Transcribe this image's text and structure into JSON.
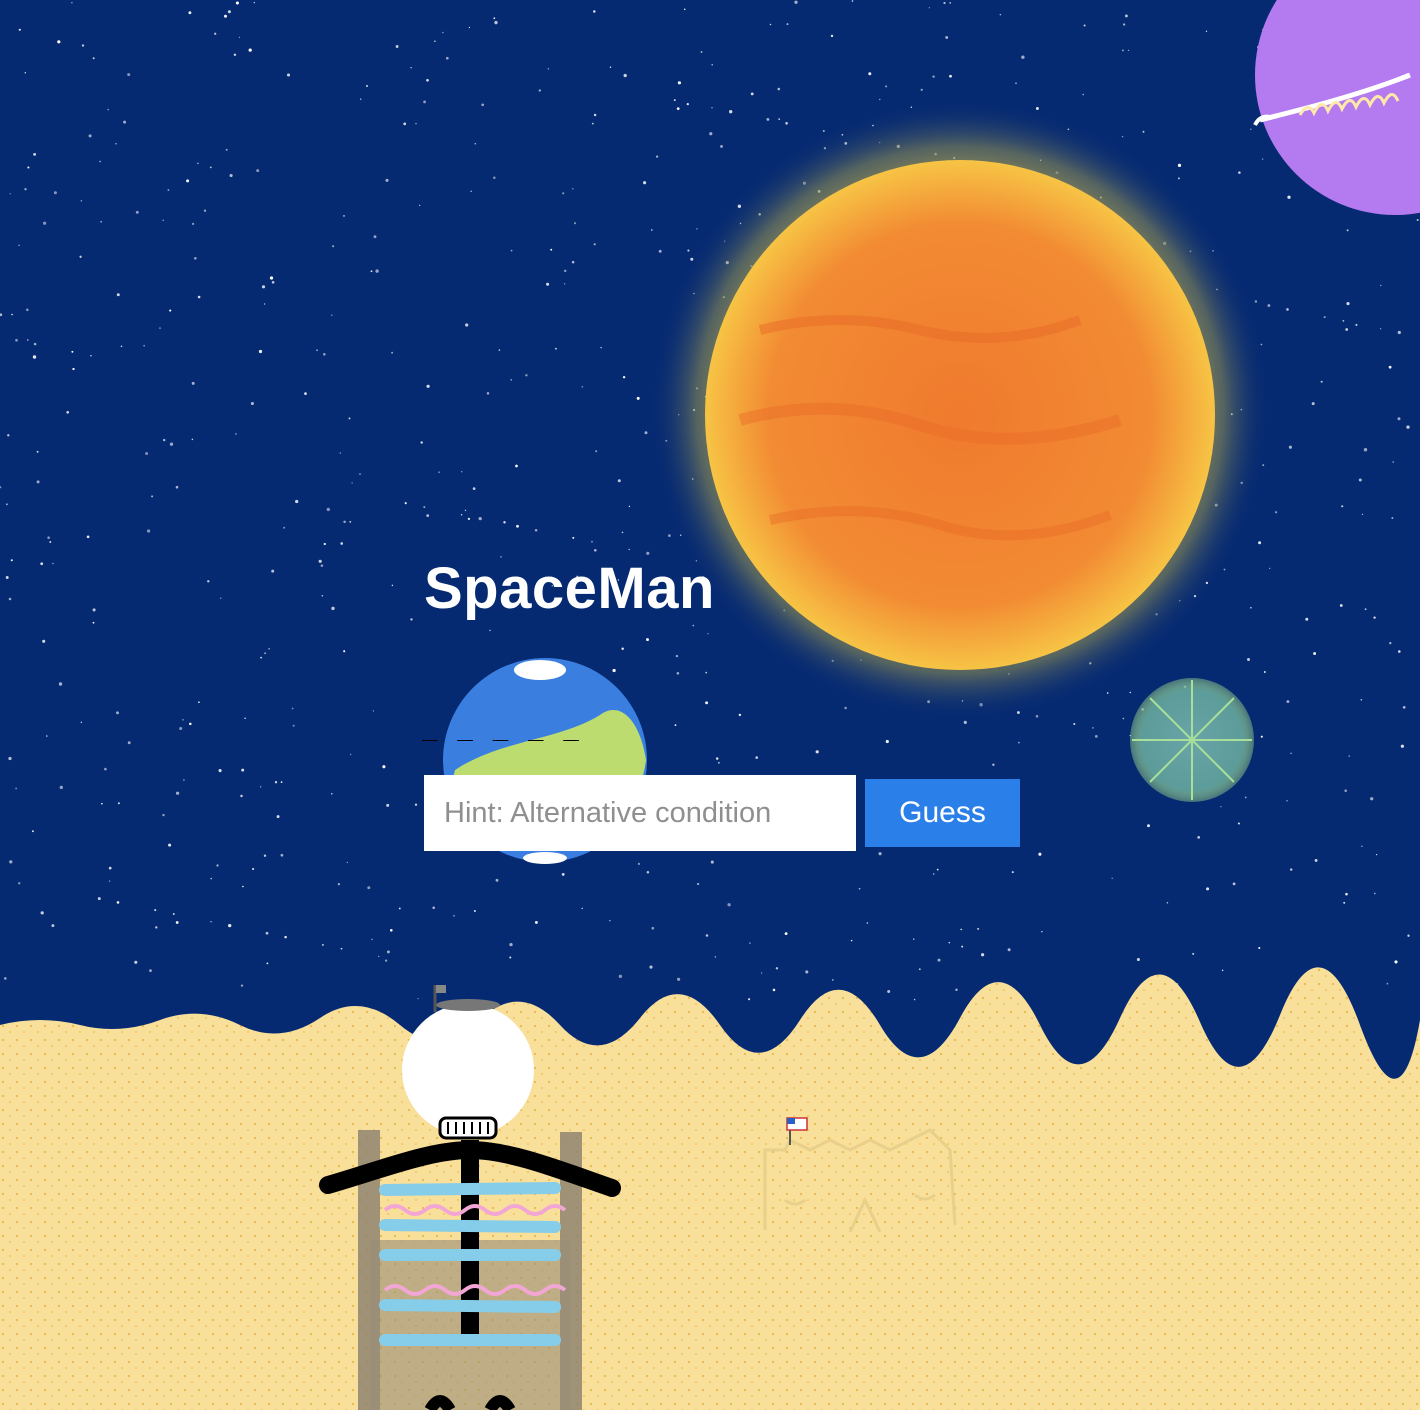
{
  "game": {
    "title": "SpaceMan",
    "word_blanks": "_ _ _ _ _",
    "guess_input": {
      "value": "",
      "placeholder": "Hint: Alternative condition"
    },
    "guess_button_label": "Guess"
  },
  "colors": {
    "sky": "#062a72",
    "sand": "#f8df9a",
    "sun": "#f08a34",
    "button": "#2b7fe9",
    "planet": "#b47af0",
    "earth_ocean": "#3a7fe0",
    "earth_land": "#bcdc70"
  }
}
